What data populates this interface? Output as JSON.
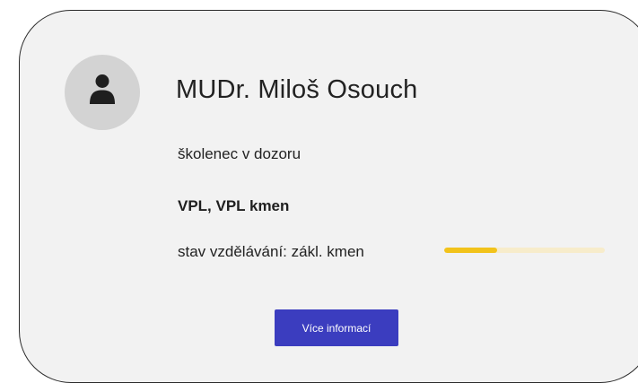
{
  "profile": {
    "name": "MUDr. Miloš Osouch",
    "role": "školenec v dozoru",
    "specialty": "VPL, VPL kmen",
    "status_label": "stav vzdělávání: zákl. kmen",
    "progress": 0.33,
    "avatar_icon": "user-icon"
  },
  "actions": {
    "more_info_label": "Více informací"
  },
  "colors": {
    "card_background": "#f2f2f2",
    "avatar_background": "#d3d3d3",
    "progress_fill": "#f2c31b",
    "progress_track": "#f7eccb",
    "button_background": "#3b3dbf"
  }
}
